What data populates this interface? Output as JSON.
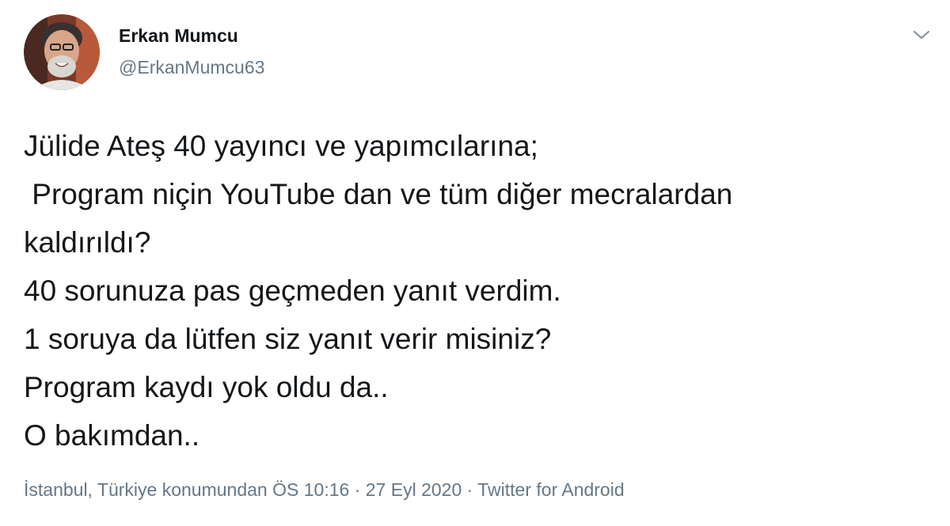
{
  "author": {
    "display_name": "Erkan Mumcu",
    "handle": "@ErkanMumcu63",
    "avatar_icon": "user-photo-avatar"
  },
  "menu": {
    "icon": "chevron-down-icon"
  },
  "tweet": {
    "lines": [
      "Jülide Ateş 40 yayıncı ve yapımcılarına;",
      " Program niçin YouTube dan ve tüm diğer mecralardan",
      "kaldırıldı?",
      "40 sorunuza pas geçmeden yanıt verdim.",
      "1 soruya da lütfen siz yanıt verir misiniz?",
      "Program kaydı yok oldu da..",
      "O bakımdan.."
    ]
  },
  "meta": {
    "location": "İstanbul, Türkiye konumundan",
    "time": "ÖS 10:16",
    "separator": " · ",
    "date": "27 Eyl 2020",
    "source": "Twitter for Android"
  },
  "colors": {
    "text": "#14171a",
    "secondary": "#657786"
  }
}
